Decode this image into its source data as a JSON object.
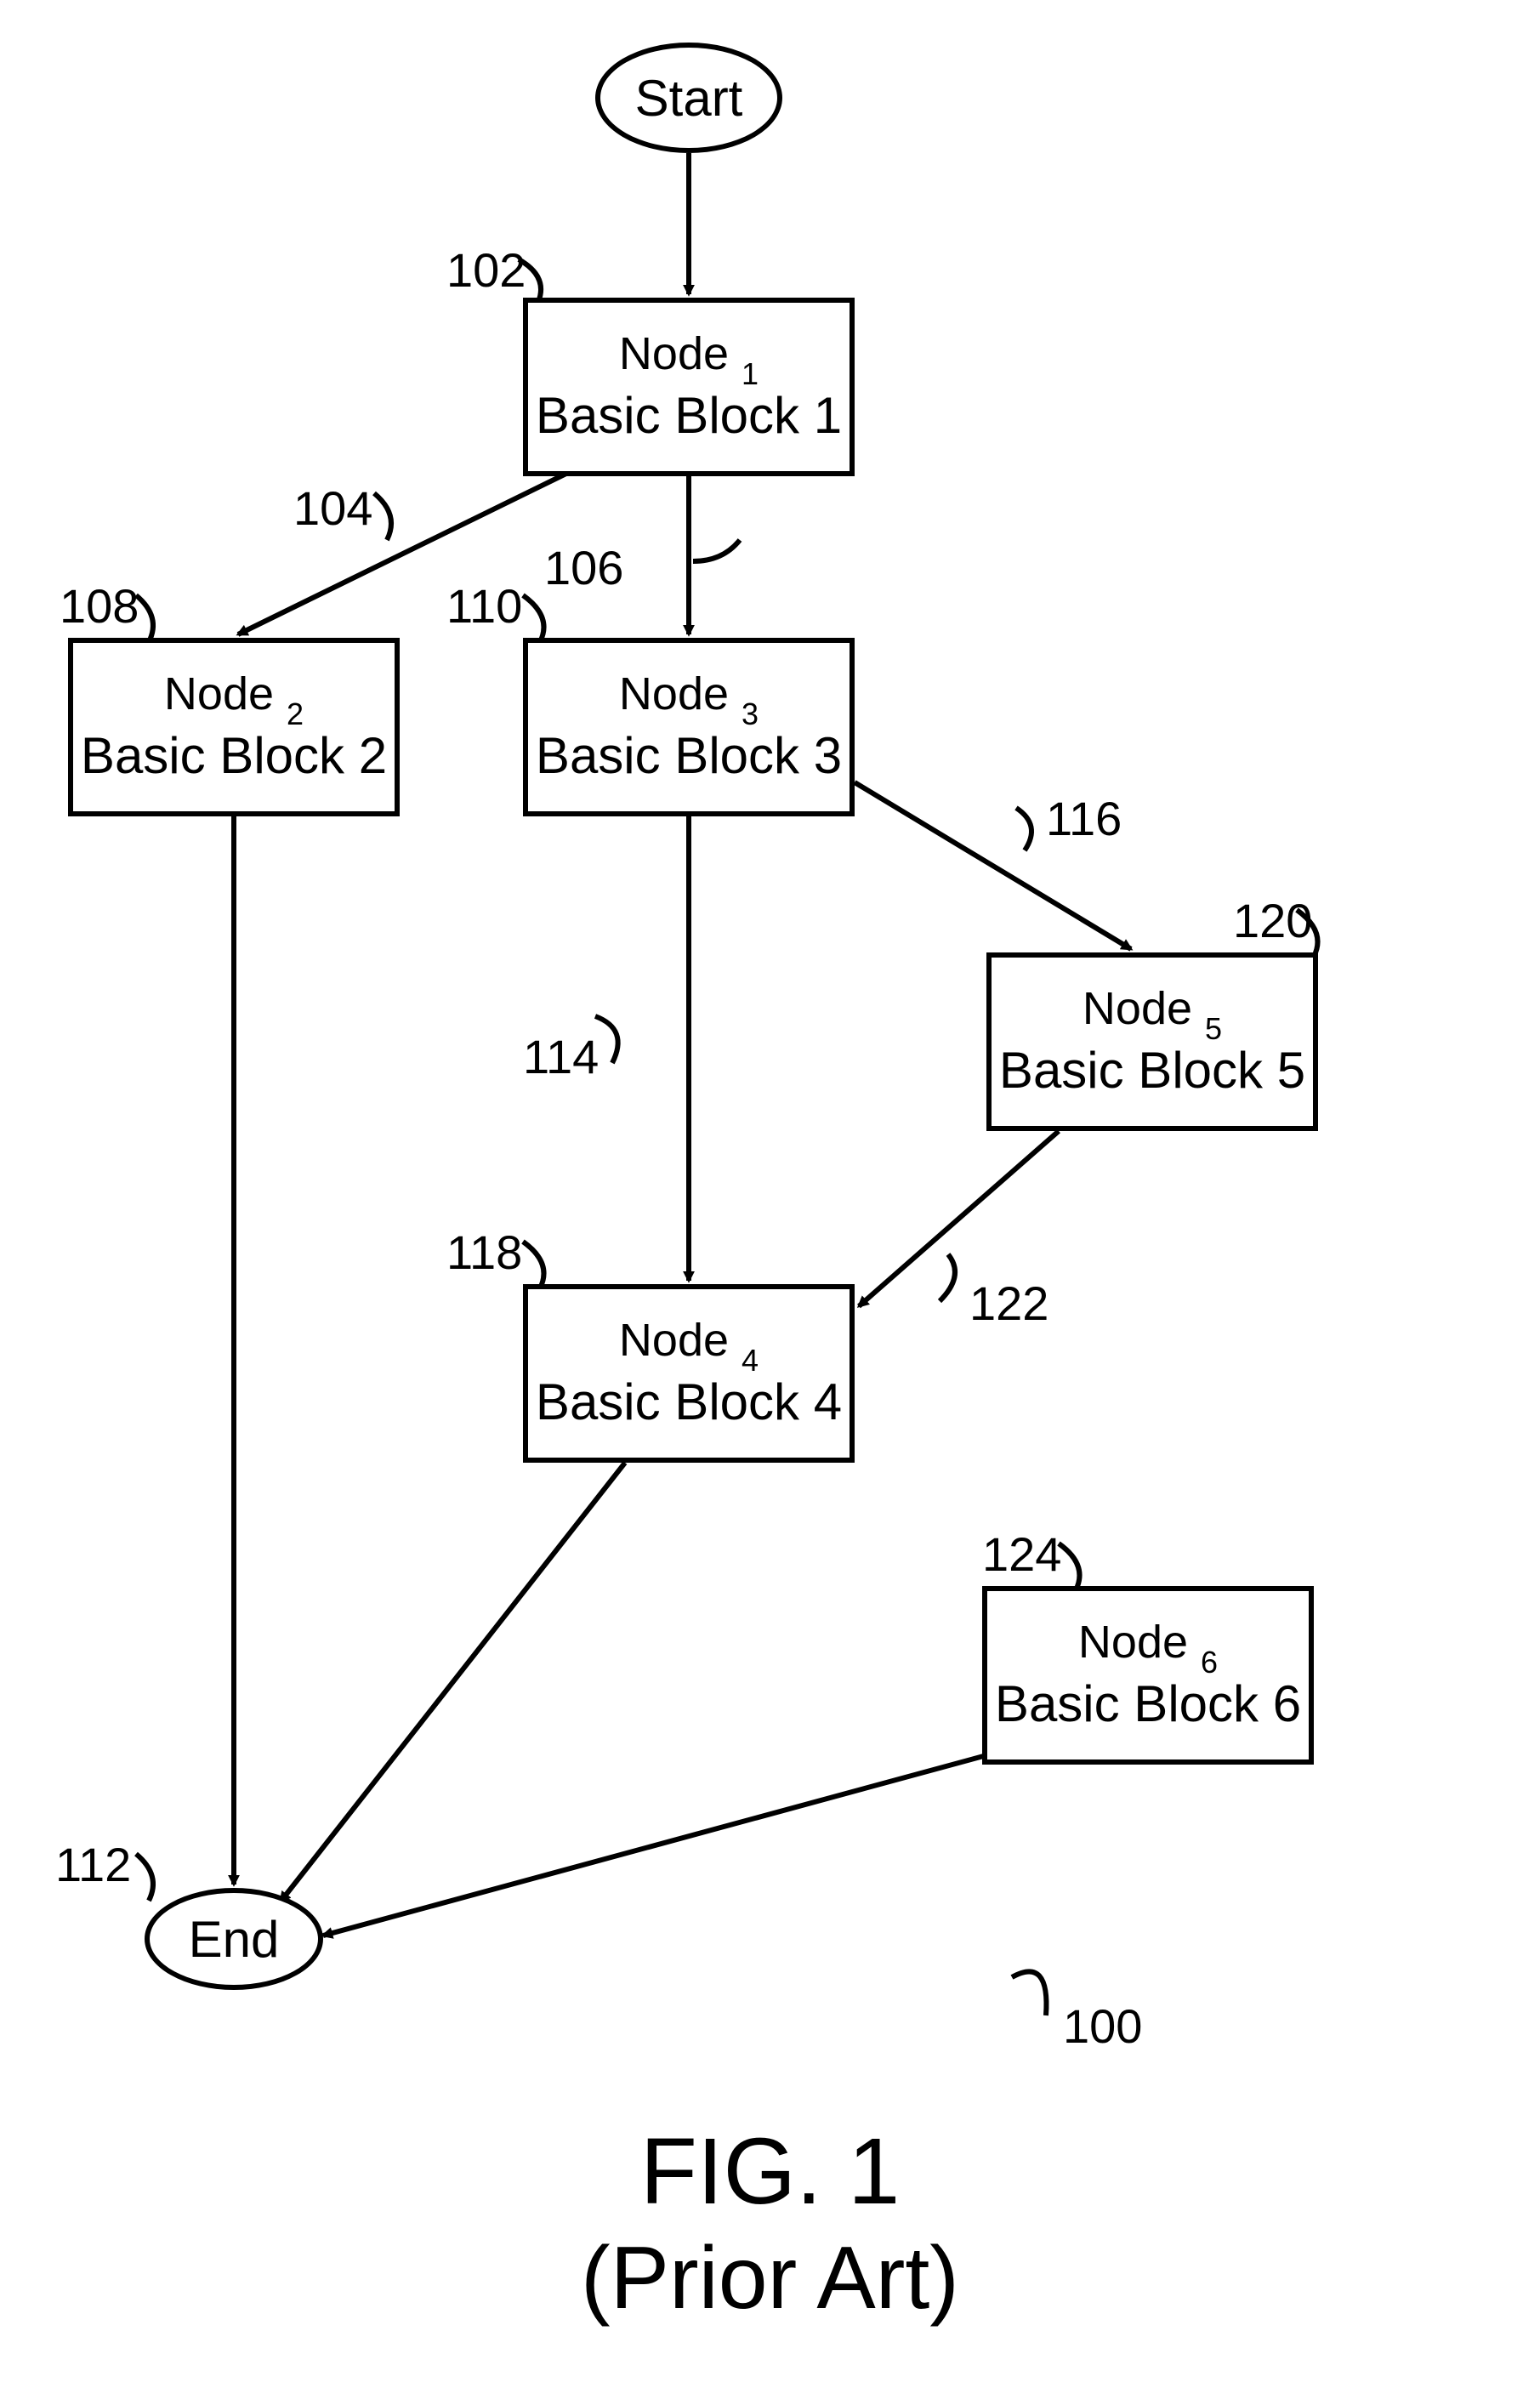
{
  "terminals": {
    "start": "Start",
    "end": "End"
  },
  "nodes": {
    "n1": {
      "top_pre": "Node ",
      "top_sub": "1",
      "bottom": "Basic Block 1"
    },
    "n2": {
      "top_pre": "Node ",
      "top_sub": "2",
      "bottom": "Basic Block 2"
    },
    "n3": {
      "top_pre": "Node ",
      "top_sub": "3",
      "bottom": "Basic Block 3"
    },
    "n4": {
      "top_pre": "Node ",
      "top_sub": "4",
      "bottom": "Basic Block 4"
    },
    "n5": {
      "top_pre": "Node ",
      "top_sub": "5",
      "bottom": "Basic Block 5"
    },
    "n6": {
      "top_pre": "Node ",
      "top_sub": "6",
      "bottom": "Basic Block 6"
    }
  },
  "refs": {
    "r100": "100",
    "r102": "102",
    "r104": "104",
    "r106": "106",
    "r108": "108",
    "r110": "110",
    "r112": "112",
    "r114": "114",
    "r116": "116",
    "r118": "118",
    "r120": "120",
    "r122": "122",
    "r124": "124"
  },
  "figure": {
    "title": "FIG. 1",
    "subtitle": "(Prior Art)"
  }
}
